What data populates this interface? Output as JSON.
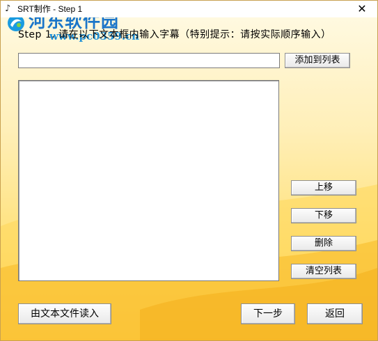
{
  "window": {
    "title": "SRT制作 - Step 1",
    "close_glyph": "✕",
    "app_icon": "music-note-icon"
  },
  "watermark": {
    "title": "河东软件园",
    "url": "www.pc0359.cn"
  },
  "step1": {
    "instruction": "Step 1. 请在以下文本框内输入字幕（特别提示：请按实际顺序输入）",
    "input_value": "",
    "add_label": "添加到列表",
    "list_items": []
  },
  "side_buttons": {
    "up": "上移",
    "down": "下移",
    "delete": "删除",
    "clear": "清空列表"
  },
  "footer": {
    "import": "由文本文件读入",
    "next": "下一步",
    "back": "返回"
  },
  "colors": {
    "background_top": "#fff9e0",
    "background_bottom": "#fcc840",
    "watermark_blue": "#1a75c9"
  }
}
